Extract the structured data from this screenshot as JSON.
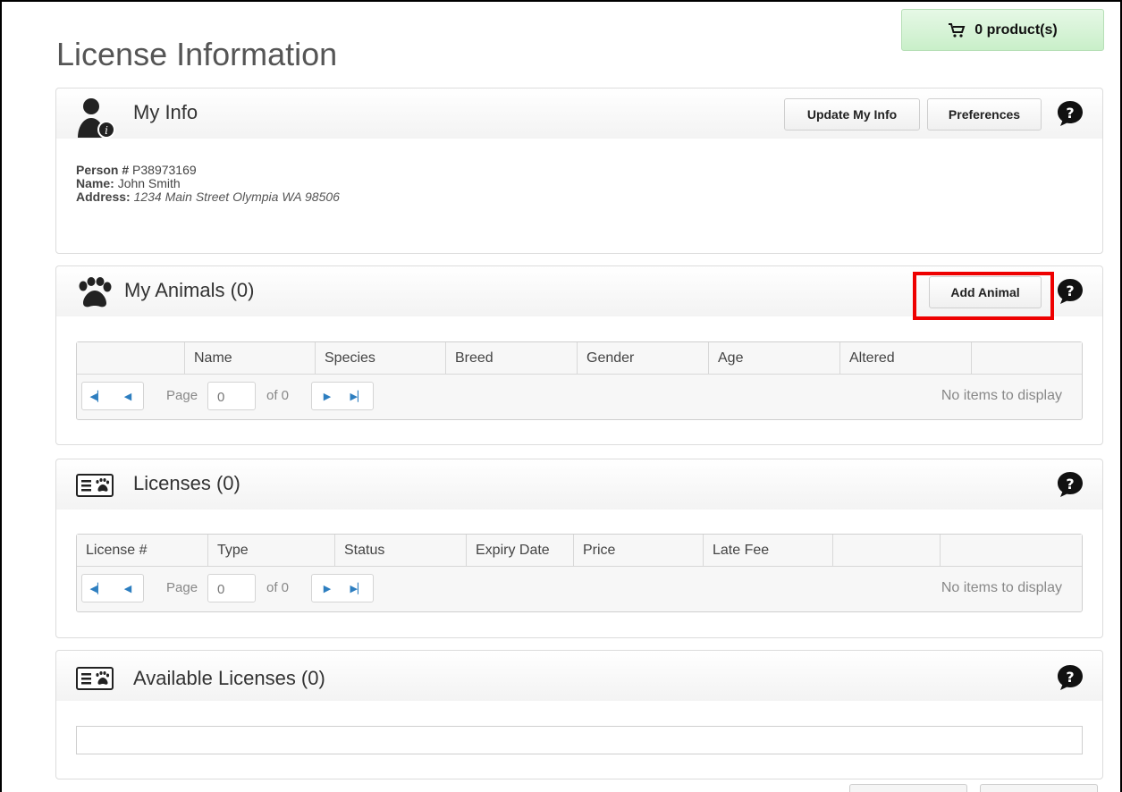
{
  "page": {
    "title": "License Information"
  },
  "cart": {
    "label": "0 product(s)"
  },
  "my_info": {
    "title": "My Info",
    "update_btn": "Update My Info",
    "prefs_btn": "Preferences",
    "person_label": "Person #",
    "person_value": "P38973169",
    "name_label": "Name:",
    "name_value": "John Smith",
    "address_label": "Address:",
    "address_value": "1234 Main Street Olympia WA 98506"
  },
  "animals": {
    "title": "My Animals (0)",
    "add_btn": "Add Animal",
    "columns": [
      "",
      "Name",
      "Species",
      "Breed",
      "Gender",
      "Age",
      "Altered",
      ""
    ],
    "pager": {
      "page_label": "Page",
      "page_value": "0",
      "of_label": "of 0",
      "empty": "No items to display"
    }
  },
  "licenses": {
    "title": "Licenses (0)",
    "columns": [
      "License #",
      "Type",
      "Status",
      "Expiry Date",
      "Price",
      "Late Fee",
      "",
      ""
    ],
    "pager": {
      "page_label": "Page",
      "page_value": "0",
      "of_label": "of 0",
      "empty": "No items to display"
    }
  },
  "available": {
    "title": "Available Licenses (0)"
  },
  "colors": {
    "cart_bg": "#d4f3d4",
    "highlight": "#ee0000"
  }
}
